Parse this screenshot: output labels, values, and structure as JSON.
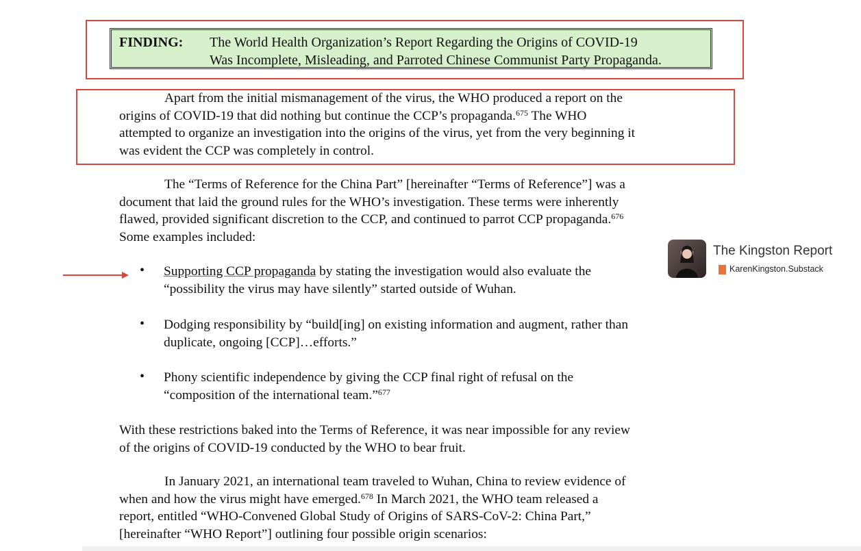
{
  "finding": {
    "label": "FINDING:",
    "line1": "The World Health Organization’s Report Regarding the Origins of COVID-19",
    "line2": "Was Incomplete, Misleading, and Parroted Chinese Communist Party Propaganda."
  },
  "para1": {
    "l1": "Apart from the initial mismanagement of the virus, the WHO produced a report on the",
    "l2a": "origins of COVID-19 that did nothing but continue the CCP’s propaganda.",
    "l2sup": "675",
    "l2b": " The WHO",
    "l3": "attempted to organize an investigation into the origins of the virus, yet from the very beginning it",
    "l4": "was evident the CCP was completely in control."
  },
  "para2": {
    "l1": "The “Terms of Reference for the China Part” [hereinafter “Terms of Reference”] was a",
    "l2": "document that laid the ground rules for the WHO’s investigation. These terms were inherently",
    "l3a": "flawed, provided significant discretion to the CCP, and continued to parrot CCP propaganda.",
    "l3sup": "676",
    "l4": "Some examples included:"
  },
  "bullets": [
    {
      "dot": "•",
      "lead": "Supporting CCP propaganda",
      "l1rest": " by stating the investigation would also evaluate the",
      "l2": "“possibility the virus may have silently” started outside of Wuhan."
    },
    {
      "dot": "•",
      "l1": "Dodging responsibility by “build[ing] on existing information and augment, rather than",
      "l2": "duplicate, ongoing [CCP]…efforts.”"
    },
    {
      "dot": "•",
      "l1": "Phony scientific independence by giving the CCP final right of refusal on the",
      "l2": "“composition of the international team.”",
      "sup": "677"
    }
  ],
  "para3": {
    "l1": "With these restrictions baked into the Terms of Reference, it was near impossible for any review",
    "l2": "of the origins of COVID-19 conducted by the WHO to bear fruit."
  },
  "para4": {
    "l1": "In January 2021, an international team traveled to Wuhan, China to review evidence of",
    "l2a": "when and how the virus might have emerged.",
    "l2sup": "678",
    "l2b": " In March 2021, the WHO team released a",
    "l3": "report, entitled “WHO-Convened Global Study of Origins of SARS-CoV-2: China Part,”",
    "l4": "[hereinafter “WHO Report”] outlining four possible origin scenarios:"
  },
  "watermark": {
    "title": "The Kingston Report",
    "subtitle": "KarenKingston.Substack"
  },
  "colors": {
    "highlight_box": "#d6f0cc",
    "annotation_red": "#d9463f"
  }
}
